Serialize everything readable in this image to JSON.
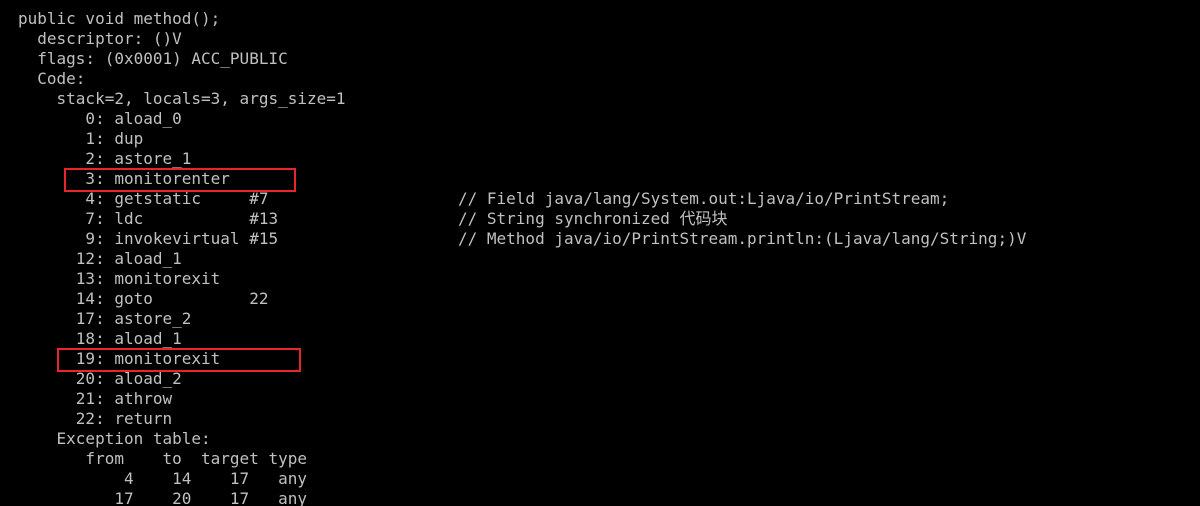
{
  "console": {
    "lines": [
      "public void method();",
      "  descriptor: ()V",
      "  flags: (0x0001) ACC_PUBLIC",
      "  Code:",
      "    stack=2, locals=3, args_size=1",
      "       0: aload_0",
      "       1: dup",
      "       2: astore_1",
      "       3: monitorenter",
      "       4: getstatic     #7",
      "       7: ldc           #13",
      "       9: invokevirtual #15",
      "      12: aload_1",
      "      13: monitorexit",
      "      14: goto          22",
      "      17: astore_2",
      "      18: aload_1",
      "      19: monitorexit",
      "      20: aload_2",
      "      21: athrow",
      "      22: return",
      "    Exception table:",
      "       from    to  target type",
      "           4    14    17   any",
      "          17    20    17   any"
    ],
    "comments": [
      "// Field java/lang/System.out:Ljava/io/PrintStream;",
      "// String synchronized 代码块",
      "// Method java/io/PrintStream.println:(Ljava/lang/String;)V"
    ]
  },
  "highlight_color": "#e8242c",
  "text_color": "#c0c0c0",
  "background_color": "#000000"
}
